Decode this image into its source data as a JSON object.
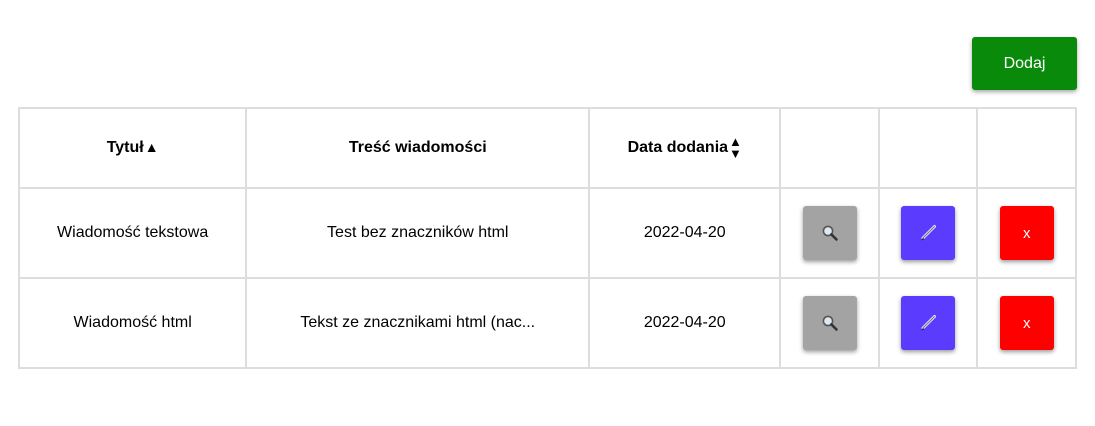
{
  "toolbar": {
    "add_label": "Dodaj",
    "add_color": "#0a8a0a"
  },
  "table": {
    "headers": {
      "title": "Tytuł",
      "content": "Treść wiadomości",
      "date": "Data dodania"
    },
    "sort_icons": {
      "title": "sort-ascending-icon",
      "date": "sort-both-icon",
      "up_glyph": "▲",
      "down_glyph": "▼"
    },
    "rows": [
      {
        "title": "Wiadomość tekstowa",
        "content": "Test bez znaczników html",
        "date": "2022-04-20",
        "delete_label": "x"
      },
      {
        "title": "Wiadomość html",
        "content": "Tekst ze znacznikami html (nac...",
        "date": "2022-04-20",
        "delete_label": "x"
      }
    ],
    "action_icons": {
      "view": "magnifier-icon",
      "edit": "pen-icon"
    },
    "action_colors": {
      "view": "#a3a3a3",
      "edit": "#5b3cff",
      "delete": "#ff0000"
    }
  }
}
